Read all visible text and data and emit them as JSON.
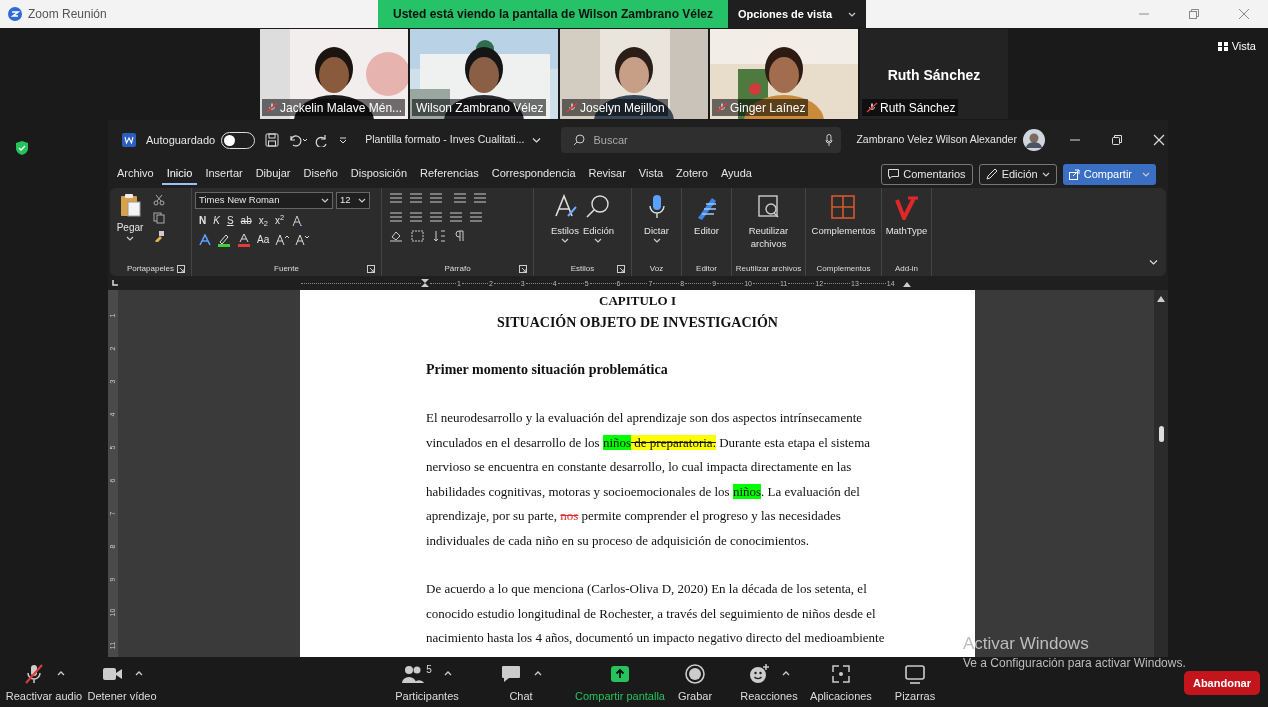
{
  "window": {
    "title": "Zoom Reunión"
  },
  "banner": {
    "text": "Usted está viendo la pantalla de Wilson Zambrano Vélez",
    "view_options": "Opciones de vista"
  },
  "participants": [
    {
      "name": "Jackelin Malave Mén...",
      "video": true,
      "muted": true,
      "speaking": false
    },
    {
      "name": "Wilson Zambrano Vélez",
      "video": true,
      "muted": false,
      "speaking": true
    },
    {
      "name": "Joselyn Mejillon",
      "video": true,
      "muted": true,
      "speaking": false
    },
    {
      "name": "Ginger Laínez",
      "video": true,
      "muted": true,
      "speaking": false
    },
    {
      "name": "Ruth Sánchez",
      "video": false,
      "display_name": "Ruth Sánchez",
      "muted": true,
      "speaking": false
    }
  ],
  "view_button": "Vista",
  "word": {
    "autosave_label": "Autoguardado",
    "autosave_on": false,
    "doc_title": "Plantilla formato - Inves Cualitati...",
    "search_placeholder": "Buscar",
    "user": "Zambrano Velez Wilson Alexander",
    "tabs": [
      {
        "label": "Archivo",
        "selected": false
      },
      {
        "label": "Inicio",
        "selected": true
      },
      {
        "label": "Insertar",
        "selected": false
      },
      {
        "label": "Dibujar",
        "selected": false
      },
      {
        "label": "Diseño",
        "selected": false
      },
      {
        "label": "Disposición",
        "selected": false
      },
      {
        "label": "Referencias",
        "selected": false
      },
      {
        "label": "Correspondencia",
        "selected": false
      },
      {
        "label": "Revisar",
        "selected": false
      },
      {
        "label": "Vista",
        "selected": false
      },
      {
        "label": "Zotero",
        "selected": false
      },
      {
        "label": "Ayuda",
        "selected": false
      }
    ],
    "actions": [
      "Comentarios",
      "Edición",
      "Compartir"
    ],
    "ribbon": {
      "paste": "Pegar",
      "font_name": "Times New Roman",
      "font_size": "12",
      "format_letters": [
        "N",
        "K",
        "S",
        "ab",
        "x$_{2}$",
        "x$^{2}$"
      ],
      "case_button": "Aa",
      "big_buttons": [
        {
          "label": "Estilos",
          "kind": "styles"
        },
        {
          "label": "Edición",
          "kind": "find"
        },
        {
          "label": "Dictar",
          "kind": "mic"
        },
        {
          "label": "Editor",
          "kind": "editor"
        },
        {
          "label": "Reutilizar archivos",
          "kind": "reuse"
        },
        {
          "label": "Complementos",
          "kind": "addins"
        },
        {
          "label": "MathType",
          "kind": "mathtype"
        }
      ],
      "group_labels": [
        "Portapapeles",
        "Fuente",
        "Párrafo",
        "Estilos",
        "Voz",
        "Editor",
        "Reutilizar archivos",
        "Complementos",
        "Add-in"
      ]
    },
    "ruler": [
      "1",
      "2",
      "3",
      "4",
      "5",
      "6",
      "7",
      "8",
      "9",
      "10",
      "11",
      "12",
      "13",
      "14"
    ],
    "vertical_ruler": [
      "1",
      "2",
      "3",
      "4",
      "5",
      "6",
      "7",
      "8",
      "9",
      "10",
      "11"
    ],
    "document": [
      {
        "kind": "chapter",
        "text": "CAPITULO I"
      },
      {
        "kind": "title",
        "text": "SITUACIÓN OBJETO DE INVESTIGACIÓN"
      },
      {
        "kind": "subtitle",
        "text": "Primer momento situación problemática"
      },
      {
        "kind": "paragraph",
        "segments": [
          {
            "text": "El neurodesarrollo y la evaluación del aprendizaje son dos aspectos intrínsecamente vinculados en el desarrollo de los "
          },
          {
            "text": "niños",
            "kind": "highlight",
            "color": "#00ff00"
          },
          {
            "text": " de preparatoria.",
            "kind": "deleted-highlight",
            "color": "#ffff00"
          },
          {
            "text": " Durante esta etapa el sistema nervioso se encuentra en constante desarrollo, lo cual impacta directamente en las habilidades cognitivas, motoras y socioemocionales de los "
          },
          {
            "text": "niños",
            "kind": "highlight",
            "color": "#00ff00"
          },
          {
            "text": ". La evaluación del aprendizaje, por su parte, "
          },
          {
            "text": "nos",
            "kind": "deleted",
            "color": "#e03030"
          },
          {
            "text": " permite comprender el progreso y las necesidades individuales de cada niño en su proceso de adquisición de conocimientos."
          }
        ]
      },
      {
        "kind": "paragraph",
        "segments": [
          {
            "text": "De acuerdo a lo que menciona (Carlos-Oliva D, 2020) En la década de los setenta, el conocido estudio longitudinal de Rochester, a través del seguimiento de niños desde el nacimiento hasta los 4 años, documentó un impacto negativo directo del medioambiente"
          }
        ]
      }
    ]
  },
  "toolbar": [
    {
      "label": "Reactivar audio",
      "kind": "mic-off",
      "caret": true
    },
    {
      "label": "Detener vídeo",
      "kind": "video",
      "caret": true
    },
    {
      "label": "Participantes",
      "kind": "participants",
      "count": "5",
      "caret": true
    },
    {
      "label": "Chat",
      "kind": "chat",
      "caret": true
    },
    {
      "label": "Compartir pantalla",
      "kind": "share",
      "caret": false
    },
    {
      "label": "Grabar",
      "kind": "record",
      "caret": false
    },
    {
      "label": "Reacciones",
      "kind": "reactions",
      "caret": true
    },
    {
      "label": "Aplicaciones",
      "kind": "apps",
      "caret": false
    },
    {
      "label": "Pizarras",
      "kind": "whiteboard",
      "caret": false
    }
  ],
  "leave_button": "Abandonar",
  "activation": {
    "title": "Activar Windows",
    "subtitle": "Ve a Configuración para activar Windows."
  }
}
